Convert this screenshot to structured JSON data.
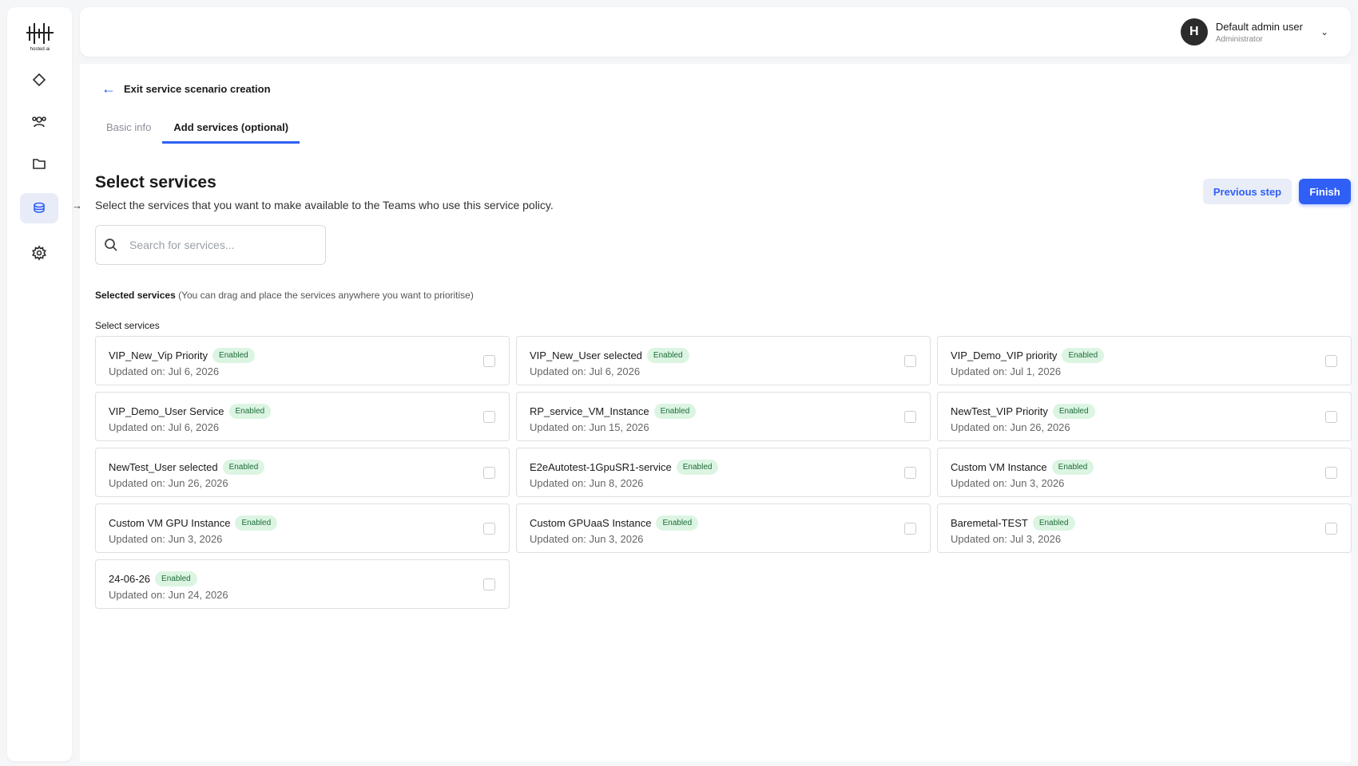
{
  "logo": {
    "text": "hosted·ai"
  },
  "header": {
    "user_initial": "H",
    "user_name": "Default admin user",
    "user_role": "Administrator"
  },
  "page": {
    "exit_label": "Exit service scenario creation",
    "tabs": [
      {
        "label": "Basic info",
        "active": false
      },
      {
        "label": "Add services (optional)",
        "active": true
      }
    ],
    "title": "Select services",
    "subtitle": "Select the services that you want to make available to the Teams who use this service policy.",
    "prev_label": "Previous step",
    "finish_label": "Finish",
    "search_placeholder": "Search for services...",
    "selected_label": "Selected services",
    "selected_hint": "(You can drag and place the services anywhere you want to prioritise)",
    "select_label": "Select services"
  },
  "services": [
    {
      "name": "VIP_New_Vip Priority",
      "status": "Enabled",
      "date_prefix": "Updated on:",
      "date": "Jul 6, 2026"
    },
    {
      "name": "VIP_New_User selected",
      "status": "Enabled",
      "date_prefix": "Updated on:",
      "date": "Jul 6, 2026"
    },
    {
      "name": "VIP_Demo_VIP priority",
      "status": "Enabled",
      "date_prefix": "Updated on:",
      "date": "Jul 1, 2026"
    },
    {
      "name": "VIP_Demo_User Service",
      "status": "Enabled",
      "date_prefix": "Updated on:",
      "date": "Jul 6, 2026"
    },
    {
      "name": "RP_service_VM_Instance",
      "status": "Enabled",
      "date_prefix": "Updated on:",
      "date": "Jun 15, 2026"
    },
    {
      "name": "NewTest_VIP Priority",
      "status": "Enabled",
      "date_prefix": "Updated on:",
      "date": "Jun 26, 2026"
    },
    {
      "name": "NewTest_User selected",
      "status": "Enabled",
      "date_prefix": "Updated on:",
      "date": "Jun 26, 2026"
    },
    {
      "name": "E2eAutotest-1GpuSR1-service",
      "status": "Enabled",
      "date_prefix": "Updated on:",
      "date": "Jun 8, 2026"
    },
    {
      "name": "Custom VM Instance",
      "status": "Enabled",
      "date_prefix": "Updated on:",
      "date": "Jun 3, 2026"
    },
    {
      "name": "Custom VM GPU Instance",
      "status": "Enabled",
      "date_prefix": "Updated on:",
      "date": "Jun 3, 2026"
    },
    {
      "name": "Custom GPUaaS Instance",
      "status": "Enabled",
      "date_prefix": "Updated on:",
      "date": "Jun 3, 2026"
    },
    {
      "name": "Baremetal-TEST",
      "status": "Enabled",
      "date_prefix": "Updated on:",
      "date": "Jul 3, 2026"
    },
    {
      "name": "24-06-26",
      "status": "Enabled",
      "date_prefix": "Updated on:",
      "date": "Jun 24, 2026"
    }
  ]
}
